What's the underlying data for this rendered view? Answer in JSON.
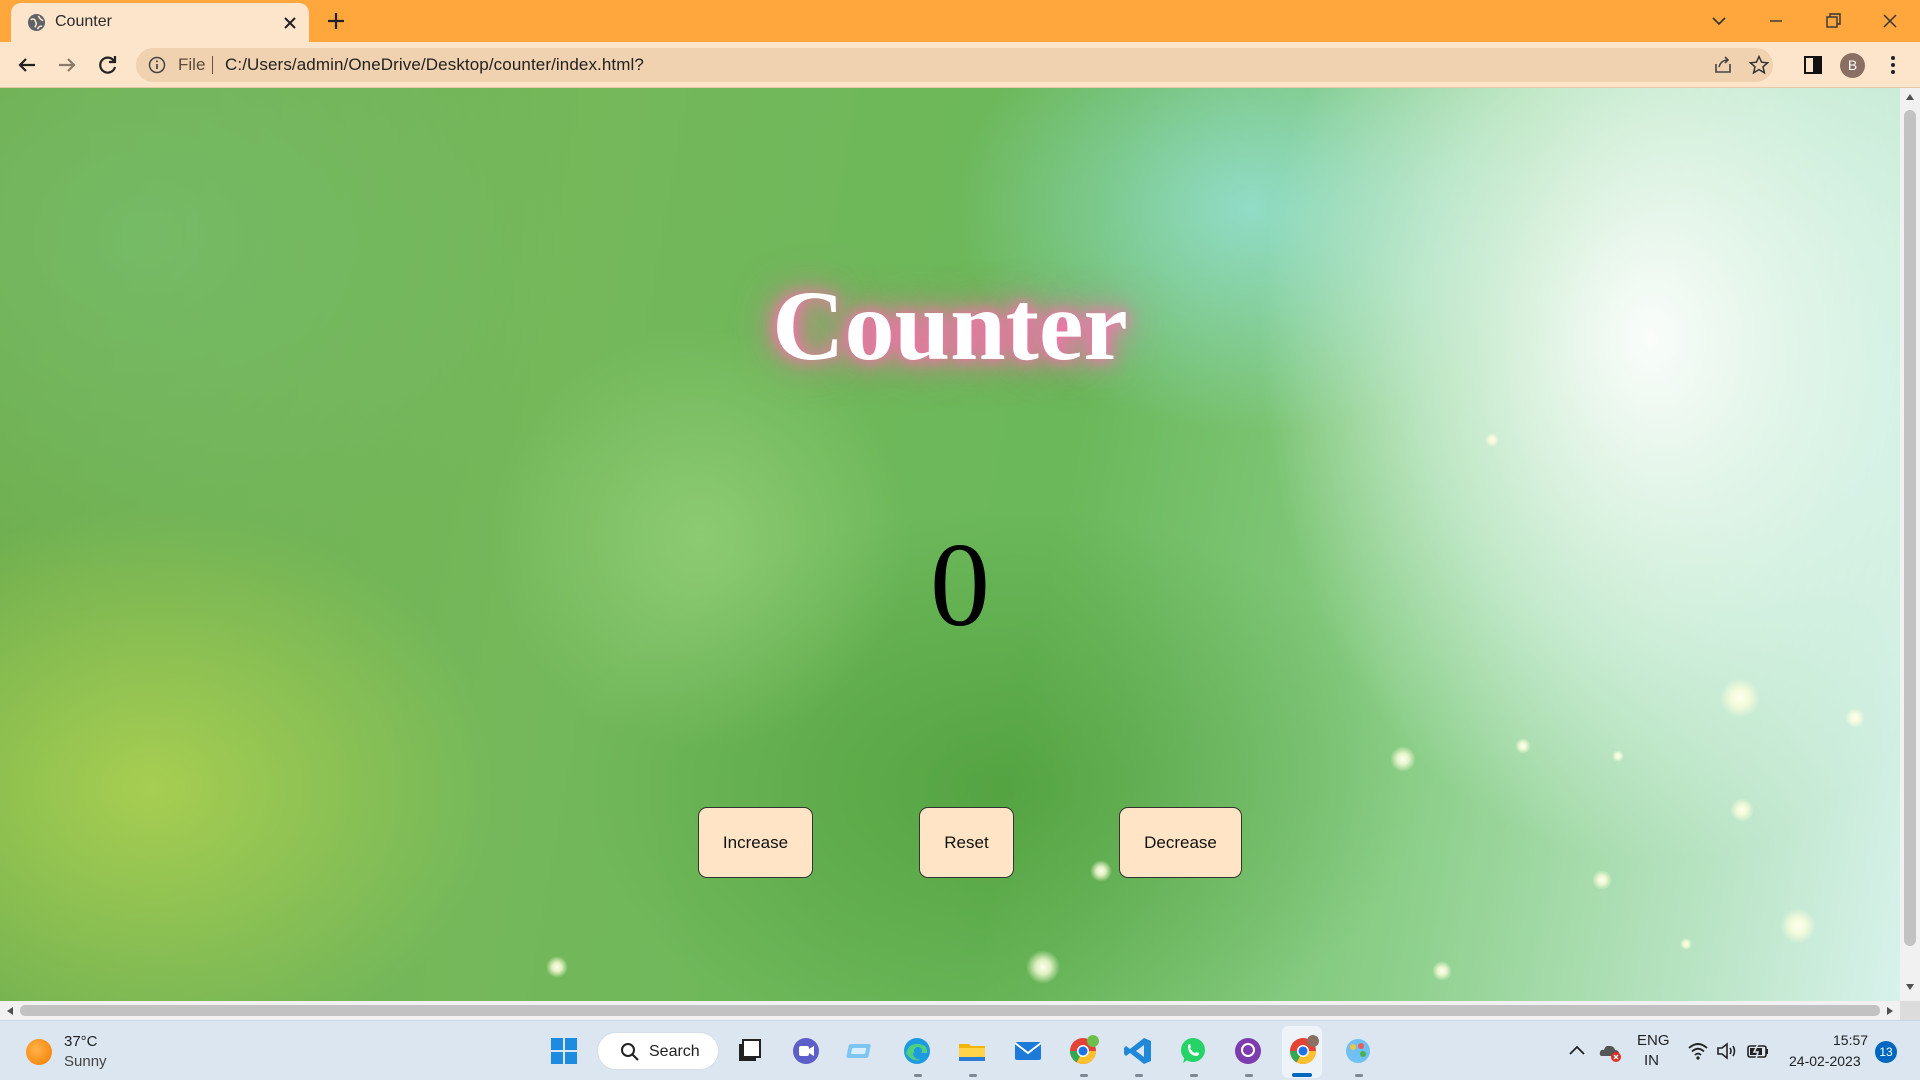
{
  "browser": {
    "tab_title": "Counter",
    "address_prefix": "File",
    "url": "C:/Users/admin/OneDrive/Desktop/counter/index.html?",
    "profile_initial": "B"
  },
  "page": {
    "title": "Counter",
    "count": "0",
    "buttons": {
      "increase": "Increase",
      "reset": "Reset",
      "decrease": "Decrease"
    },
    "colors": {
      "button_bg": "#ffe5c6",
      "title_glow": "#ff6fb3"
    }
  },
  "taskbar": {
    "weather_temp": "37°C",
    "weather_desc": "Sunny",
    "search_label": "Search",
    "tray": {
      "language": "ENG",
      "region": "IN",
      "time": "15:57",
      "date": "24-02-2023",
      "notification_count": "13"
    }
  }
}
